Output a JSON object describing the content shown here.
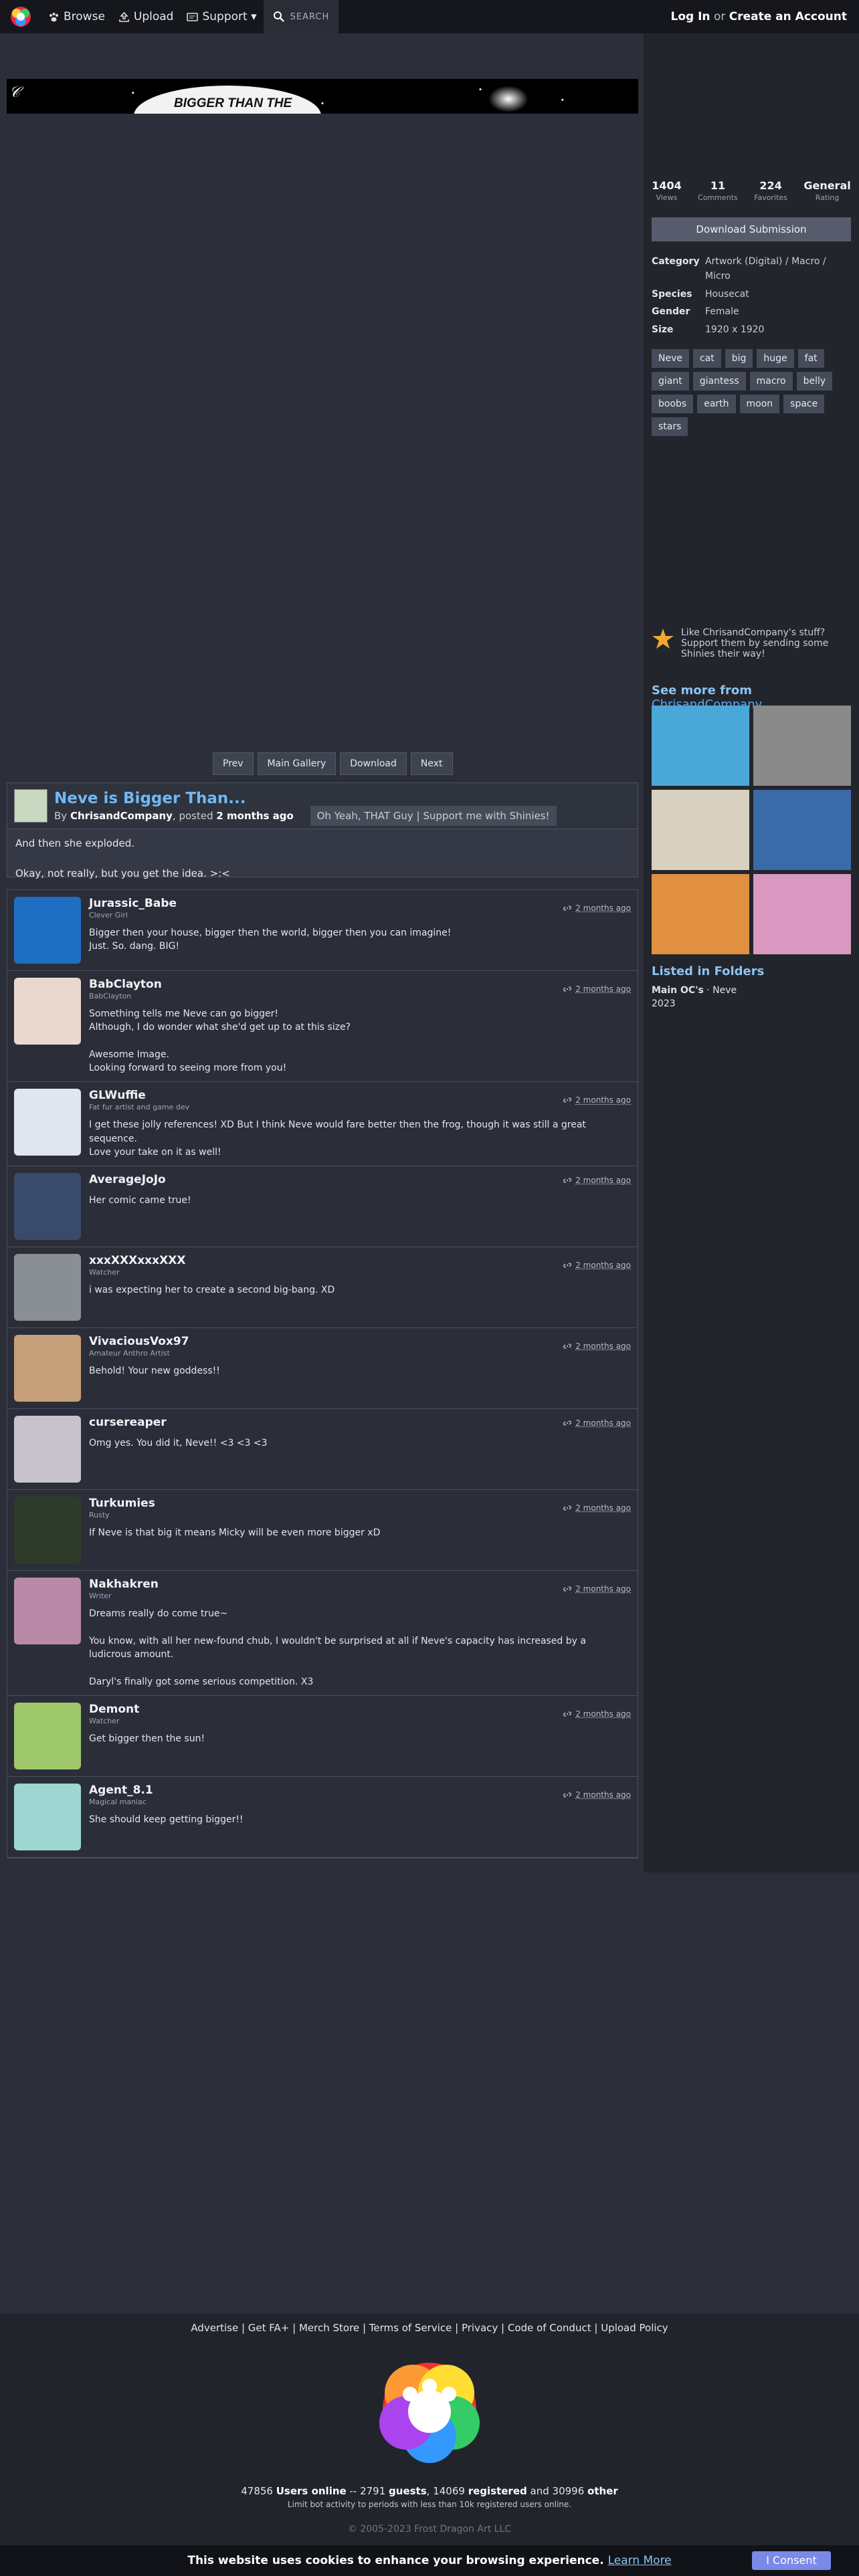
{
  "nav": {
    "browse": "Browse",
    "upload": "Upload",
    "support": "Support ▾",
    "search": "SEARCH",
    "login": "Log In",
    "or": "or",
    "create": "Create an Account"
  },
  "banner": {
    "title": "BIGGER THAN THE"
  },
  "buttons": {
    "prev": "Prev",
    "main_gallery": "Main Gallery",
    "download": "Download",
    "next": "Next"
  },
  "submission": {
    "title": "Neve is Bigger Than...",
    "by": "By",
    "author": "ChrisandCompany",
    "posted": ", posted",
    "posted_when": "2 months ago",
    "author_tagline": "Oh Yeah, THAT Guy | Support me with Shinies!",
    "description": "And then she exploded.\n\nOkay, not really, but you get the idea. >:<"
  },
  "comments": [
    {
      "name": "Jurassic_Babe",
      "title": "Clever Girl",
      "date": "2 months ago",
      "text": "Bigger then your house, bigger then the world, bigger then you can imagine!\nJust. So. dang. BIG!"
    },
    {
      "name": "BabClayton",
      "title": "BabClayton",
      "date": "2 months ago",
      "text": "Something tells me Neve can go bigger!\nAlthough, I do wonder what she'd get up to at this size?\n\nAwesome Image.\nLooking forward to seeing more from you!"
    },
    {
      "name": "GLWuffie",
      "title": "Fat fur artist and game dev",
      "date": "2 months ago",
      "text": "I get these jolly references! XD But I think Neve would fare better then the frog, though it was still a great sequence.\nLove your take on it as well!"
    },
    {
      "name": "AverageJoJo",
      "title": "",
      "date": "2 months ago",
      "text": "Her comic came true!"
    },
    {
      "name": "xxxXXXxxxXXX",
      "title": "Watcher",
      "date": "2 months ago",
      "text": "i was expecting her to create a second big-bang. XD"
    },
    {
      "name": "VivaciousVox97",
      "title": "Amateur Anthro Artist",
      "date": "2 months ago",
      "text": "Behold! Your new goddess!!"
    },
    {
      "name": "cursereaper",
      "title": "",
      "date": "2 months ago",
      "text": "Omg yes. You did it, Neve!! <3 <3 <3"
    },
    {
      "name": "Turkumies",
      "title": "Rusty",
      "date": "2 months ago",
      "text": "If Neve is that big it means Micky will be even more bigger xD"
    },
    {
      "name": "Nakhakren",
      "title": "Writer",
      "date": "2 months ago",
      "text": "Dreams really do come true~\n\nYou know, with all her new-found chub, I wouldn't be surprised at all if Neve's capacity has increased by a ludicrous amount.\n\nDaryl's finally got some serious competition. X3"
    },
    {
      "name": "Demont",
      "title": "Watcher",
      "date": "2 months ago",
      "text": "Get bigger then the sun!"
    },
    {
      "name": "Agent_8.1",
      "title": "Magical maniac",
      "date": "2 months ago",
      "text": "She should keep getting bigger!!"
    }
  ],
  "comment_avatar_colors": [
    "#1e6fc4",
    "#e8d8d0",
    "#dfe6ee",
    "#3a4a6a",
    "#8a8f96",
    "#c6a07a",
    "#c7c3cc",
    "#2e3b2a",
    "#b88aa8",
    "#9ec86a",
    "#9ed6d2"
  ],
  "stats": {
    "views": "1404",
    "views_label": "Views",
    "comments": "11",
    "comments_label": "Comments",
    "favorites": "224",
    "favorites_label": "Favorites",
    "rating": "General",
    "rating_label": "Rating"
  },
  "download_submission": "Download Submission",
  "props": {
    "category_label": "Category",
    "category": "Artwork (Digital) / Macro / Micro",
    "species_label": "Species",
    "species": "Housecat",
    "gender_label": "Gender",
    "gender": "Female",
    "size_label": "Size",
    "size": "1920 x 1920"
  },
  "tags": [
    "Neve",
    "cat",
    "big",
    "huge",
    "fat",
    "giant",
    "giantess",
    "macro",
    "belly",
    "boobs",
    "earth",
    "moon",
    "space",
    "stars"
  ],
  "shiny_text": "Like ChrisandCompany's stuff? Support them by sending some Shinies their way!",
  "see_more": {
    "prefix": "See more from",
    "author": "ChrisandCompany"
  },
  "thumb_colors": [
    "#4aa8d8",
    "#8a8a8a",
    "#d8d0c0",
    "#3a6aa8",
    "#e09040",
    "#d898c0"
  ],
  "folders": {
    "heading": "Listed in Folders",
    "folder": "Main OC's",
    "sep": "· Neve",
    "year": "2023"
  },
  "footer": {
    "links": [
      "Advertise",
      "Get FA+",
      "Merch Store",
      "Terms of Service",
      "Privacy",
      "Code of Conduct",
      "Upload Policy"
    ],
    "users_online_count": "47856",
    "users_online": "Users online",
    "guests_count": "2791",
    "guests": "guests",
    "registered_count": "14069",
    "registered": "registered",
    "and": "and",
    "other_count": "30996",
    "other": "other",
    "limit": "Limit bot activity to periods with less than 10k registered users online.",
    "copyright": "© 2005-2023 Frost Dragon Art LLC"
  },
  "cookie": {
    "text": "This website uses cookies to enhance your browsing experience.",
    "learn": "Learn More",
    "consent": "I Consent"
  },
  "colors": {
    "accent": "#71b8f5",
    "link": "#8cc4f2",
    "consent": "#7b8ae8"
  }
}
